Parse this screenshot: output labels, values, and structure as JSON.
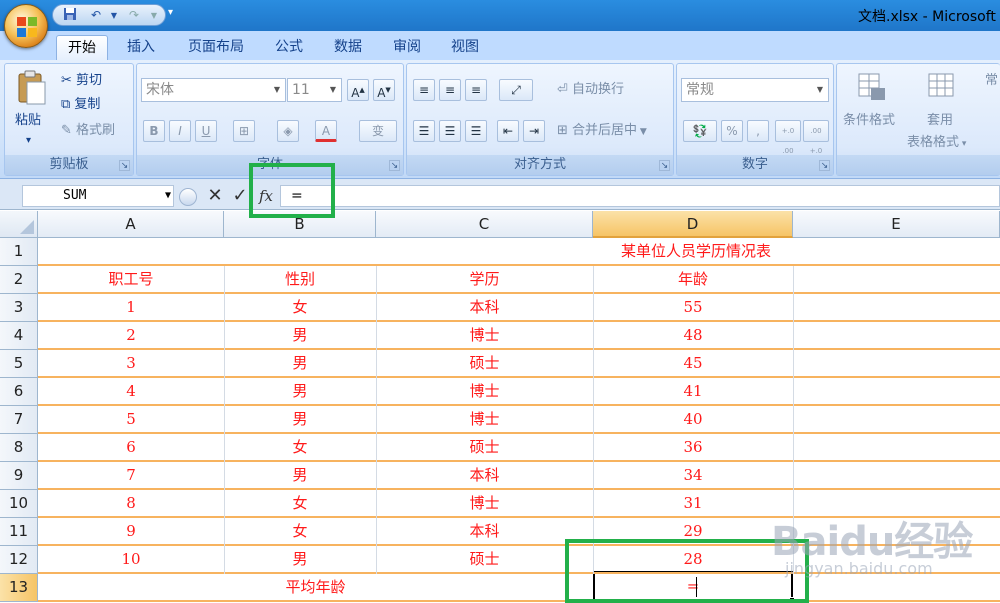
{
  "window": {
    "title": "文档.xlsx - Microsoft Excel"
  },
  "quick_access": {
    "save_icon": "save-icon",
    "undo_icon": "undo-icon",
    "redo_icon": "redo-icon"
  },
  "tabs": [
    {
      "label": "开始",
      "active": true
    },
    {
      "label": "插入"
    },
    {
      "label": "页面布局"
    },
    {
      "label": "公式"
    },
    {
      "label": "数据"
    },
    {
      "label": "审阅"
    },
    {
      "label": "视图"
    }
  ],
  "ribbon": {
    "clipboard": {
      "label": "剪贴板",
      "paste": "粘贴",
      "cut": "剪切",
      "copy": "复制",
      "format_painter": "格式刷"
    },
    "font": {
      "label": "字体",
      "font_name": "宋体",
      "font_size": "11",
      "bold": "B",
      "italic": "I",
      "underline": "U",
      "font_color": "A",
      "phonetic": "变"
    },
    "alignment": {
      "label": "对齐方式",
      "wrap_text": "自动换行",
      "merge_center": "合并后居中"
    },
    "number": {
      "label": "数字",
      "format": "常规",
      "percent": "%",
      "comma": ",",
      "inc_decimal": "+.0 .00",
      "dec_decimal": ".00 +.0"
    },
    "styles": {
      "conditional_format": "条件格式",
      "apply": "套用",
      "table_format": "表格格式",
      "cell_styles": "常"
    }
  },
  "formula_bar": {
    "name_box": "SUM",
    "cancel": "✕",
    "enter": "✓",
    "fx": "fx",
    "formula": "="
  },
  "sheet": {
    "columns": [
      "A",
      "B",
      "C",
      "D",
      "E"
    ],
    "selected_column": "D",
    "rows": [
      "1",
      "2",
      "3",
      "4",
      "5",
      "6",
      "7",
      "8",
      "9",
      "10",
      "11",
      "12",
      "13"
    ],
    "selected_row": "13",
    "title": "某单位人员学历情况表",
    "headers": [
      "职工号",
      "性别",
      "学历",
      "年龄"
    ],
    "data": [
      [
        "1",
        "女",
        "本科",
        "55"
      ],
      [
        "2",
        "男",
        "博士",
        "48"
      ],
      [
        "3",
        "男",
        "硕士",
        "45"
      ],
      [
        "4",
        "男",
        "博士",
        "41"
      ],
      [
        "5",
        "男",
        "博士",
        "40"
      ],
      [
        "6",
        "女",
        "硕士",
        "36"
      ],
      [
        "7",
        "男",
        "本科",
        "34"
      ],
      [
        "8",
        "女",
        "博士",
        "31"
      ],
      [
        "9",
        "女",
        "本科",
        "29"
      ],
      [
        "10",
        "男",
        "硕士",
        "28"
      ]
    ],
    "average_label": "平均年龄",
    "active_cell_value": "="
  },
  "watermark": {
    "text": "Baidu经验",
    "sub": "jingyan.baidu.com"
  },
  "colors": {
    "cell_text": "#ff1a1a",
    "highlight": "#22b04a",
    "ribbon": "#dce9fb"
  }
}
